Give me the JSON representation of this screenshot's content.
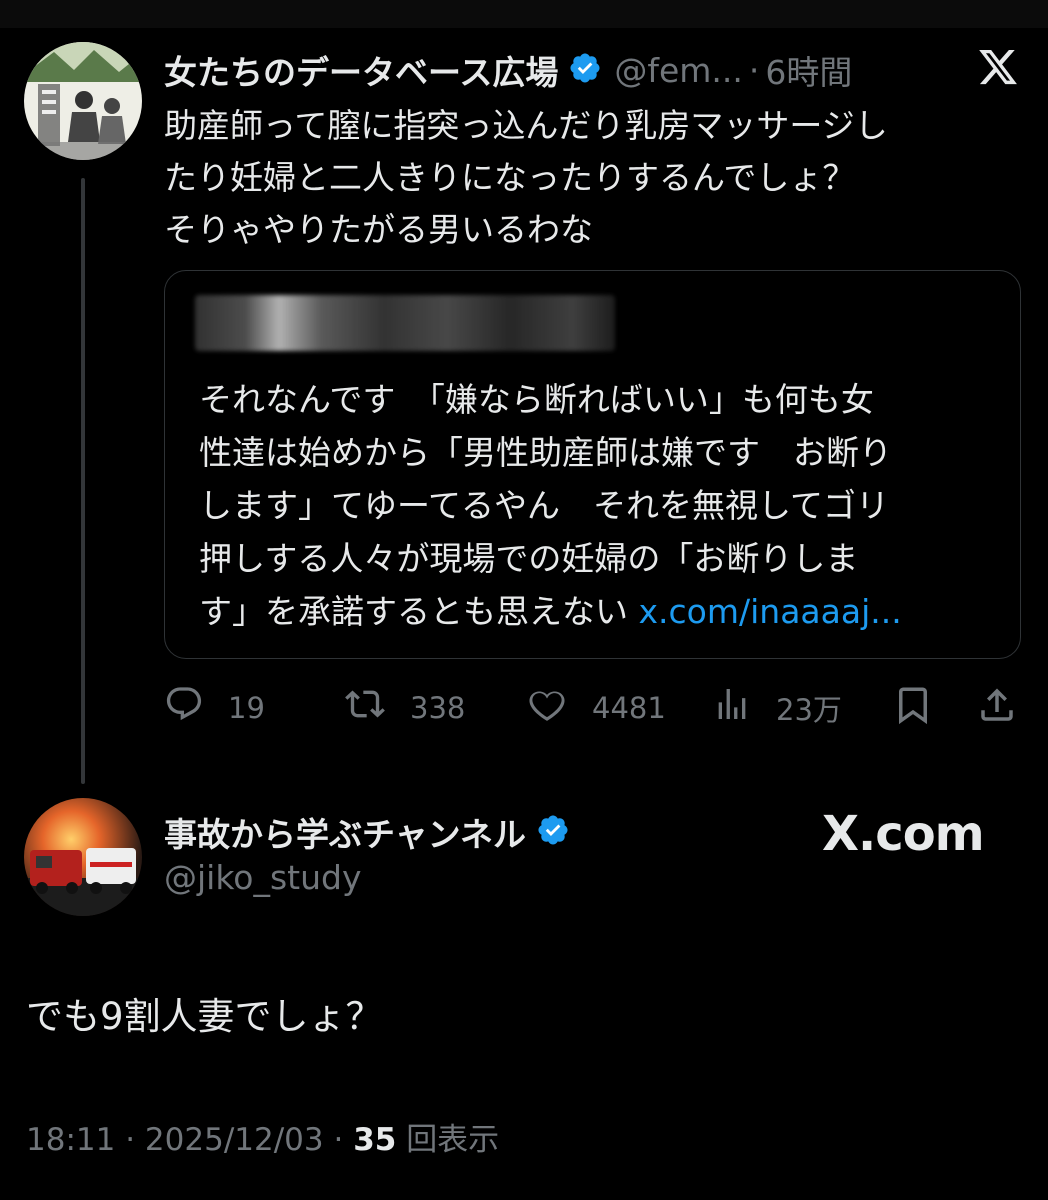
{
  "original_tweet": {
    "author_name": "女たちのデータベース広場",
    "handle": "@fem...",
    "time": "6時間",
    "text_lines": [
      "助産師って膣に指突っ込んだり乳房マッサージし",
      "たり妊婦と二人きりになったりするんでしょ？",
      "そりゃやりたがる男いるわな"
    ],
    "quote": {
      "text_lines": [
        "それなんです　「嫌なら断ればいい」も何も女",
        "性達は始めから「男性助産師は嫌です　お断り",
        "します」てゆーてるやん　それを無視してゴリ",
        "押しする人々が現場での妊婦の「お断りしま"
      ],
      "last_line": "す」を承諾するとも思えない ",
      "link": "x.com/inaaaaj..."
    },
    "actions": {
      "replies": "19",
      "retweets": "338",
      "likes": "4481",
      "views": "23万"
    }
  },
  "reply_tweet": {
    "author_name": "事故から学ぶチャンネル",
    "handle": "@jiko_study",
    "watermark": "X.com",
    "text": "でも9割人妻でしょ？",
    "time": "18:11",
    "date": "2025/12/03",
    "views_count": "35",
    "views_label": "回表示"
  },
  "colors": {
    "background": "#000000",
    "text": "#e7e9ea",
    "muted": "#71767b",
    "link": "#1d9bf0",
    "verified": "#1d9bf0"
  },
  "icons": [
    "verified-badge-icon",
    "x-logo-icon",
    "reply-icon",
    "retweet-icon",
    "like-icon",
    "views-icon",
    "bookmark-icon",
    "share-icon"
  ]
}
